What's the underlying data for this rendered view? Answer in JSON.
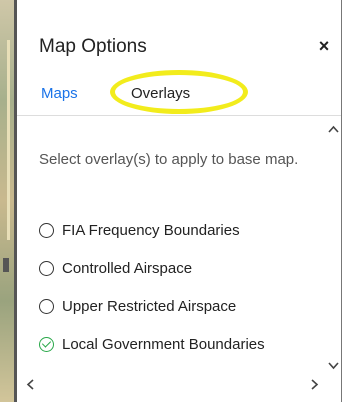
{
  "panel": {
    "title": "Map Options",
    "close_label": "×"
  },
  "tabs": [
    {
      "label": "Maps",
      "active": true
    },
    {
      "label": "Overlays",
      "active": false
    }
  ],
  "content": {
    "intro": "Select overlay(s) to apply to base map.",
    "options": [
      {
        "label": "FIA Frequency Boundaries",
        "selected": false,
        "icon": "radio-empty-icon"
      },
      {
        "label": "Controlled Airspace",
        "selected": false,
        "icon": "radio-empty-icon"
      },
      {
        "label": "Upper Restricted Airspace",
        "selected": false,
        "icon": "radio-empty-icon"
      },
      {
        "label": "Local Government Boundaries",
        "selected": true,
        "icon": "check-circle-icon"
      }
    ]
  },
  "colors": {
    "tab_active": "#1a73e8",
    "highlight": "#f2ec1c",
    "check": "#2aa84a"
  }
}
